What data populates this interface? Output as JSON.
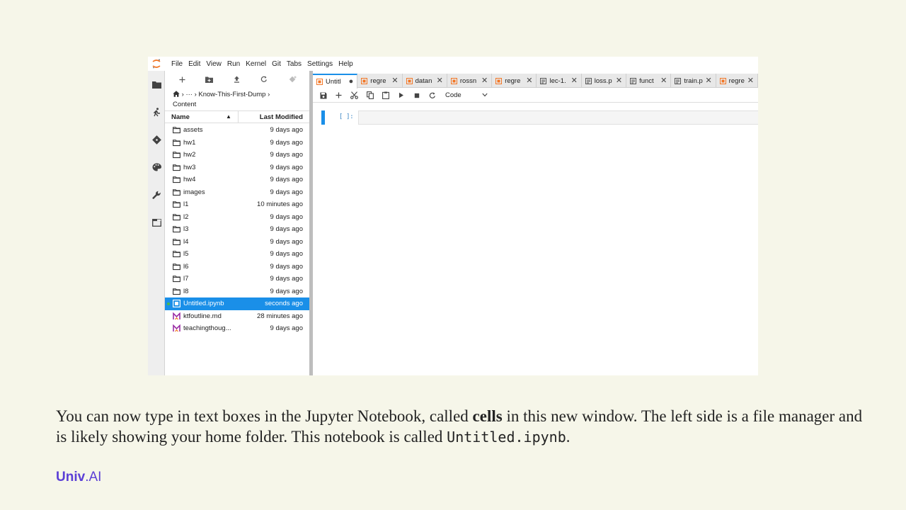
{
  "menu": [
    "File",
    "Edit",
    "View",
    "Run",
    "Kernel",
    "Git",
    "Tabs",
    "Settings",
    "Help"
  ],
  "filebrowser": {
    "breadcrumb": [
      "›",
      "···",
      "›",
      "Know-This-First-Dump",
      "›"
    ],
    "breadcrumb_line2": "Content",
    "header_name": "Name",
    "header_sort": "▲",
    "header_modified": "Last Modified",
    "rows": [
      {
        "name": "assets",
        "modified": "9 days ago",
        "kind": "folder"
      },
      {
        "name": "hw1",
        "modified": "9 days ago",
        "kind": "folder"
      },
      {
        "name": "hw2",
        "modified": "9 days ago",
        "kind": "folder"
      },
      {
        "name": "hw3",
        "modified": "9 days ago",
        "kind": "folder"
      },
      {
        "name": "hw4",
        "modified": "9 days ago",
        "kind": "folder"
      },
      {
        "name": "images",
        "modified": "9 days ago",
        "kind": "folder"
      },
      {
        "name": "l1",
        "modified": "10 minutes ago",
        "kind": "folder"
      },
      {
        "name": "l2",
        "modified": "9 days ago",
        "kind": "folder"
      },
      {
        "name": "l3",
        "modified": "9 days ago",
        "kind": "folder"
      },
      {
        "name": "l4",
        "modified": "9 days ago",
        "kind": "folder"
      },
      {
        "name": "l5",
        "modified": "9 days ago",
        "kind": "folder"
      },
      {
        "name": "l6",
        "modified": "9 days ago",
        "kind": "folder"
      },
      {
        "name": "l7",
        "modified": "9 days ago",
        "kind": "folder"
      },
      {
        "name": "l8",
        "modified": "9 days ago",
        "kind": "folder"
      },
      {
        "name": "Untitled.ipynb",
        "modified": "seconds ago",
        "kind": "notebook",
        "selected": true
      },
      {
        "name": "ktfoutline.md",
        "modified": "28 minutes ago",
        "kind": "markdown"
      },
      {
        "name": "teachingthoug...",
        "modified": "9 days ago",
        "kind": "markdown"
      }
    ]
  },
  "tabs": [
    {
      "label": "Untitl",
      "kind": "notebook",
      "active": true,
      "close": "●"
    },
    {
      "label": "regre",
      "kind": "notebook",
      "close": "✕"
    },
    {
      "label": "datan",
      "kind": "notebook",
      "close": "✕"
    },
    {
      "label": "rossn",
      "kind": "notebook",
      "close": "✕"
    },
    {
      "label": "regre",
      "kind": "notebook",
      "close": "✕"
    },
    {
      "label": "lec-1.",
      "kind": "file",
      "close": "✕"
    },
    {
      "label": "loss.p",
      "kind": "file",
      "close": "✕"
    },
    {
      "label": "funct",
      "kind": "file",
      "close": "✕"
    },
    {
      "label": "train.p",
      "kind": "file",
      "close": "✕"
    },
    {
      "label": "regre",
      "kind": "notebook",
      "close": "✕"
    }
  ],
  "notebook": {
    "cell_type": "Code",
    "cell_prompt": "[ ]:"
  },
  "caption": {
    "part1": "You can now type in text boxes in the Jupyter Notebook, called ",
    "bold": "cells",
    "part2": " in this new window. The left side is a file manager and is likely showing your home folder. This notebook is called ",
    "mono": "Untitled.ipynb",
    "part3": "."
  },
  "brand": {
    "strong": "Univ",
    "rest": ".AI"
  },
  "colors": {
    "accent": "#1a8fe8",
    "notebook_icon": "#f37726",
    "markdown_icon": "#9b30a6",
    "brand": "#5b3fd6"
  }
}
